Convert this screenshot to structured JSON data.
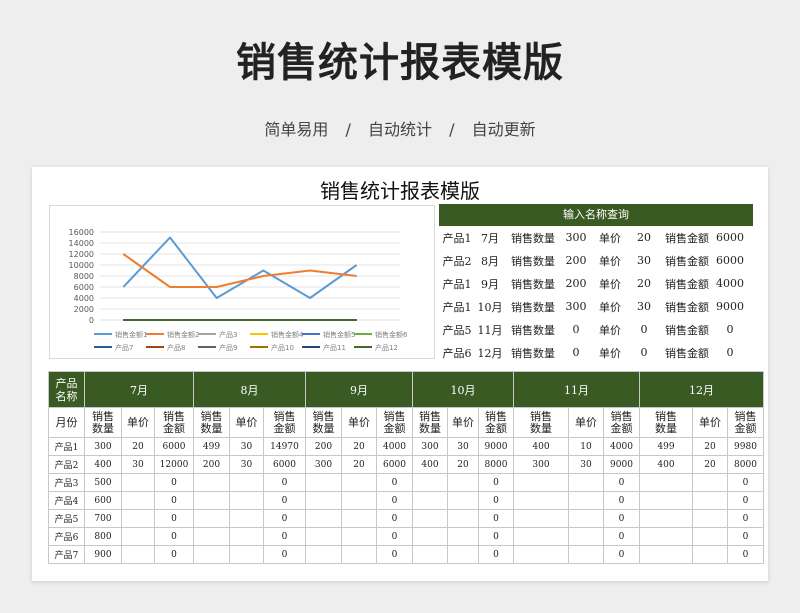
{
  "header": {
    "title": "销售统计报表模版",
    "subtitle": [
      "简单易用",
      "/",
      "自动统计",
      "/",
      "自动更新"
    ]
  },
  "sheet": {
    "title": "销售统计报表模版",
    "query": {
      "header": "输入名称查询",
      "rows": [
        {
          "product": "产品1",
          "month": "7月",
          "qty_label": "销售数量",
          "qty": "300",
          "price_label": "单价",
          "price": "20",
          "amount_label": "销售金额",
          "amount": "6000"
        },
        {
          "product": "产品2",
          "month": "8月",
          "qty_label": "销售数量",
          "qty": "200",
          "price_label": "单价",
          "price": "30",
          "amount_label": "销售金额",
          "amount": "6000"
        },
        {
          "product": "产品1",
          "month": "9月",
          "qty_label": "销售数量",
          "qty": "200",
          "price_label": "单价",
          "price": "20",
          "amount_label": "销售金额",
          "amount": "4000"
        },
        {
          "product": "产品1",
          "month": "10月",
          "qty_label": "销售数量",
          "qty": "300",
          "price_label": "单价",
          "price": "30",
          "amount_label": "销售金额",
          "amount": "9000"
        },
        {
          "product": "产品5",
          "month": "11月",
          "qty_label": "销售数量",
          "qty": "0",
          "price_label": "单价",
          "price": "0",
          "amount_label": "销售金额",
          "amount": "0"
        },
        {
          "product": "产品6",
          "month": "12月",
          "qty_label": "销售数量",
          "qty": "0",
          "price_label": "单价",
          "price": "0",
          "amount_label": "销售金额",
          "amount": "0"
        }
      ]
    },
    "table": {
      "corner_label": "产品\n名称",
      "month_label": "月份",
      "months": [
        "7月",
        "8月",
        "9月",
        "10月",
        "11月",
        "12月"
      ],
      "sub_headers": [
        "销售\n数量",
        "单价",
        "销售\n金额"
      ],
      "rows": [
        {
          "name": "产品1",
          "cells": [
            "300",
            "20",
            "6000",
            "499",
            "30",
            "14970",
            "200",
            "20",
            "4000",
            "300",
            "30",
            "9000",
            "400",
            "10",
            "4000",
            "499",
            "20",
            "9980"
          ]
        },
        {
          "name": "产品2",
          "cells": [
            "400",
            "30",
            "12000",
            "200",
            "30",
            "6000",
            "300",
            "20",
            "6000",
            "400",
            "20",
            "8000",
            "300",
            "30",
            "9000",
            "400",
            "20",
            "8000"
          ]
        },
        {
          "name": "产品3",
          "cells": [
            "500",
            "",
            "0",
            "",
            "",
            "0",
            "",
            "",
            "0",
            "",
            "",
            "0",
            "",
            "",
            "0",
            "",
            "",
            "0"
          ]
        },
        {
          "name": "产品4",
          "cells": [
            "600",
            "",
            "0",
            "",
            "",
            "0",
            "",
            "",
            "0",
            "",
            "",
            "0",
            "",
            "",
            "0",
            "",
            "",
            "0"
          ]
        },
        {
          "name": "产品5",
          "cells": [
            "700",
            "",
            "0",
            "",
            "",
            "0",
            "",
            "",
            "0",
            "",
            "",
            "0",
            "",
            "",
            "0",
            "",
            "",
            "0"
          ]
        },
        {
          "name": "产品6",
          "cells": [
            "800",
            "",
            "0",
            "",
            "",
            "0",
            "",
            "",
            "0",
            "",
            "",
            "0",
            "",
            "",
            "0",
            "",
            "",
            "0"
          ]
        },
        {
          "name": "产品7",
          "cells": [
            "900",
            "",
            "0",
            "",
            "",
            "0",
            "",
            "",
            "0",
            "",
            "",
            "0",
            "",
            "",
            "0",
            "",
            "",
            "0"
          ]
        }
      ]
    }
  },
  "chart_data": {
    "type": "line",
    "ylim": [
      0,
      16000
    ],
    "yticks": [
      "16000",
      "14000",
      "12000",
      "10000",
      "8000",
      "6000",
      "4000",
      "2000",
      "0"
    ],
    "tick_values": [
      16000,
      14000,
      12000,
      10000,
      8000,
      6000,
      4000,
      2000,
      0
    ],
    "x": [
      1,
      2,
      3,
      4,
      5,
      6
    ],
    "series": [
      {
        "name": "销售金额1",
        "color": "#5b9bd5",
        "values": [
          6000,
          15000,
          4000,
          9000,
          4000,
          10000
        ]
      },
      {
        "name": "销售金额2",
        "color": "#ed7d31",
        "values": [
          12000,
          6000,
          6000,
          8000,
          9000,
          8000
        ]
      },
      {
        "name": "产品3",
        "color": "#a5a5a5",
        "values": [
          0,
          0,
          0,
          0,
          0,
          0
        ]
      },
      {
        "name": "销售金额4",
        "color": "#ffc000",
        "values": [
          0,
          0,
          0,
          0,
          0,
          0
        ]
      },
      {
        "name": "销售金额5",
        "color": "#4472c4",
        "values": [
          0,
          0,
          0,
          0,
          0,
          0
        ]
      },
      {
        "name": "销售金额6",
        "color": "#70ad47",
        "values": [
          0,
          0,
          0,
          0,
          0,
          0
        ]
      },
      {
        "name": "产品7",
        "color": "#255e91",
        "values": [
          0,
          0,
          0,
          0,
          0,
          0
        ]
      },
      {
        "name": "产品8",
        "color": "#9e480e",
        "values": [
          0,
          0,
          0,
          0,
          0,
          0
        ]
      },
      {
        "name": "产品9",
        "color": "#636363",
        "values": [
          0,
          0,
          0,
          0,
          0,
          0
        ]
      },
      {
        "name": "产品10",
        "color": "#997300",
        "values": [
          0,
          0,
          0,
          0,
          0,
          0
        ]
      },
      {
        "name": "产品11",
        "color": "#264478",
        "values": [
          0,
          0,
          0,
          0,
          0,
          0
        ]
      },
      {
        "name": "产品12",
        "color": "#43682b",
        "values": [
          0,
          0,
          0,
          0,
          0,
          0
        ]
      }
    ]
  }
}
